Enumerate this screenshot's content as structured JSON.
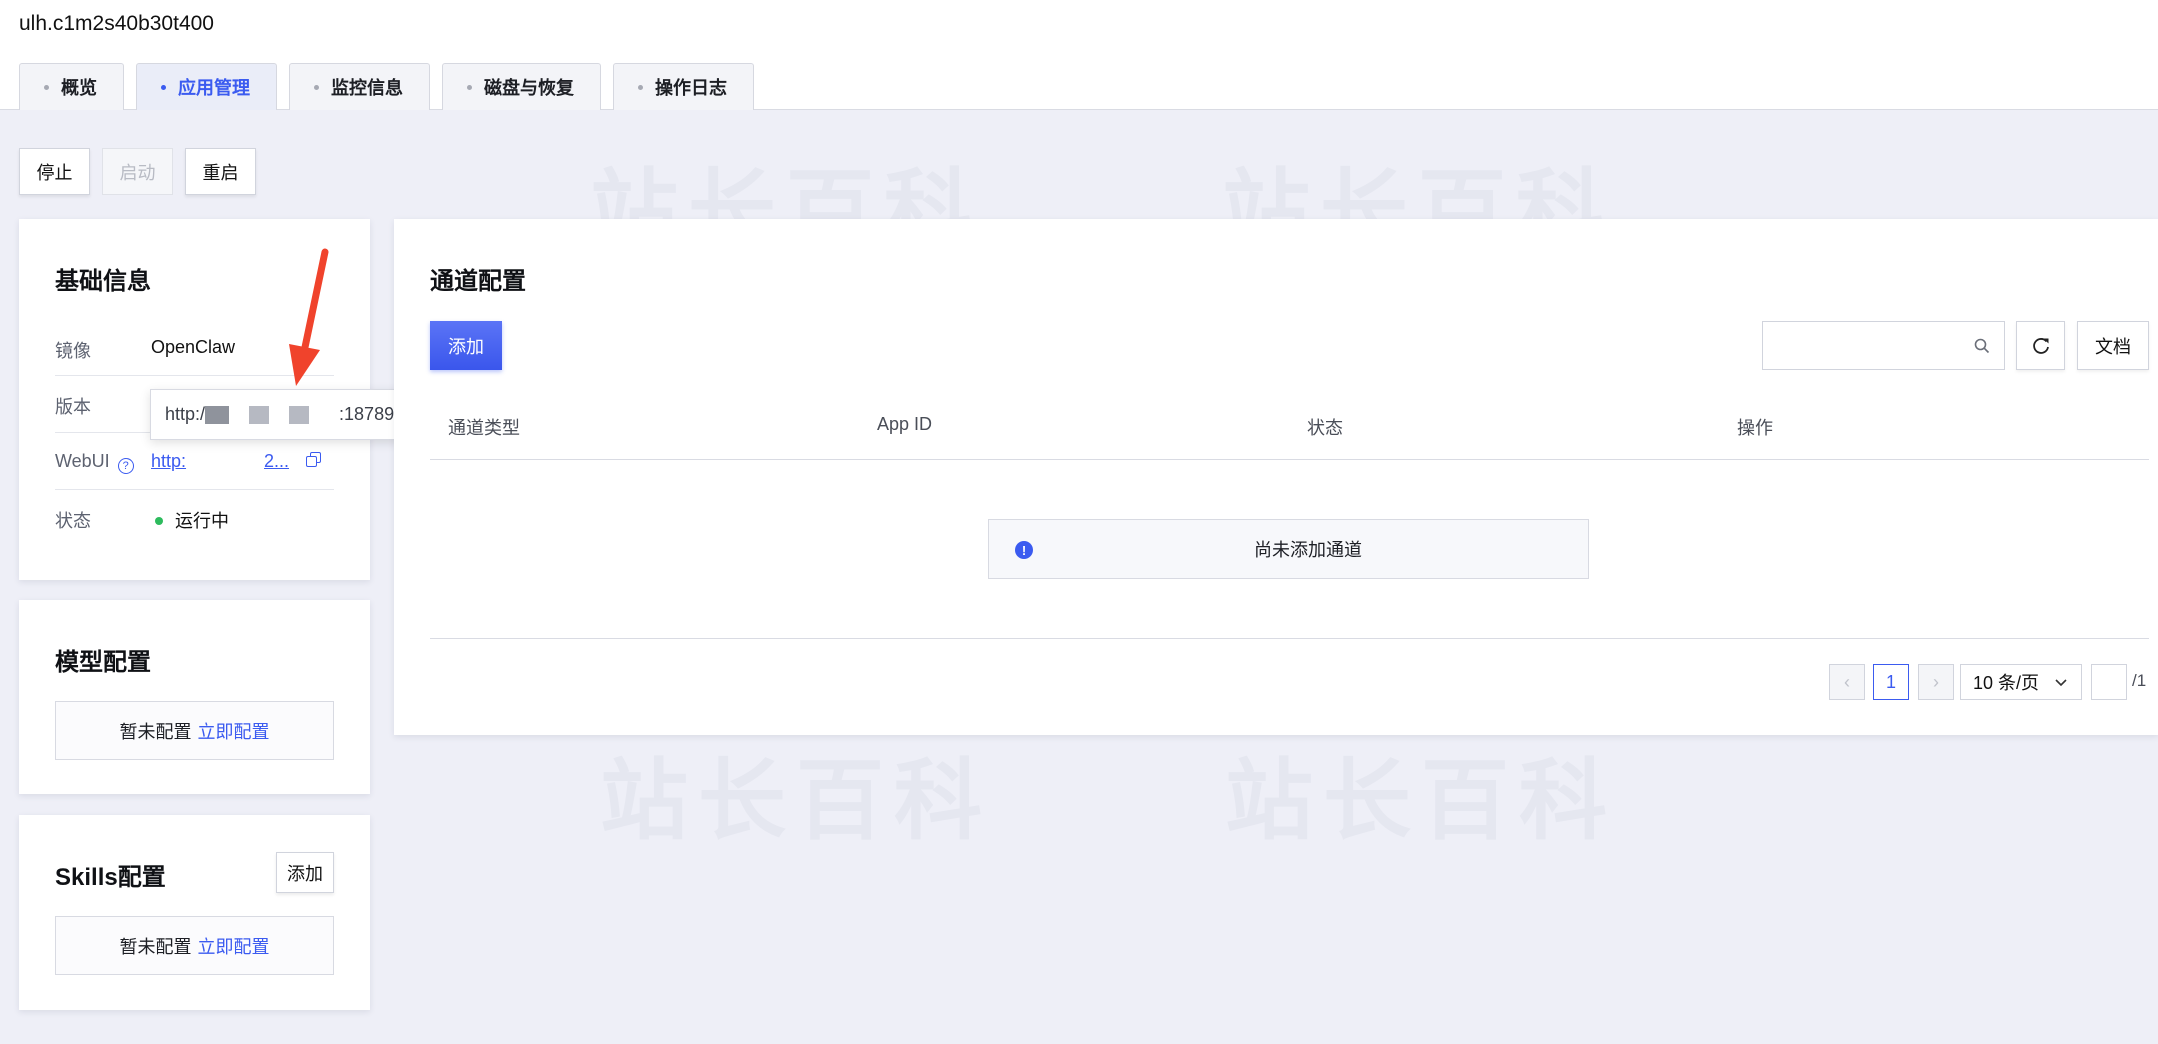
{
  "header": {
    "instance_id": "ulh.c1m2s40b30t400",
    "tabs": [
      {
        "label": "概览",
        "active": false
      },
      {
        "label": "应用管理",
        "active": true
      },
      {
        "label": "监控信息",
        "active": false
      },
      {
        "label": "磁盘与恢复",
        "active": false
      },
      {
        "label": "操作日志",
        "active": false
      }
    ]
  },
  "actions": {
    "stop": "停止",
    "start": "启动",
    "restart": "重启"
  },
  "watermark": "站长百科",
  "basic_info": {
    "title": "基础信息",
    "image_label": "镜像",
    "image_value": "OpenClaw",
    "version_label": "版本",
    "webui_label": "WebUI",
    "webui_link_start": "http:",
    "webui_link_end": "2...",
    "status_label": "状态",
    "status_value": "运行中",
    "tooltip_prefix": "http:/",
    "tooltip_suffix": ":18789"
  },
  "model_config": {
    "title": "模型配置",
    "empty_text": "暂未配置",
    "configure_link": "立即配置"
  },
  "skills_config": {
    "title": "Skills配置",
    "add_label": "添加",
    "empty_text": "暂未配置",
    "configure_link": "立即配置"
  },
  "channel_config": {
    "title": "通道配置",
    "add_label": "添加",
    "search_placeholder": "",
    "docs_label": "文档",
    "columns": [
      "通道类型",
      "App ID",
      "状态",
      "操作"
    ],
    "empty_notice": "尚未添加通道",
    "pagination": {
      "current_page": "1",
      "page_size": "10 条/页",
      "total_pages": "/1"
    }
  },
  "colors": {
    "accent": "#3b5bf0",
    "status_running": "#2dbb5d",
    "annotation_arrow": "#f0432c"
  },
  "icons": [
    "help-circle-icon",
    "copy-icon",
    "search-icon",
    "refresh-icon",
    "info-icon",
    "chevron-left-icon",
    "chevron-right-icon",
    "chevron-down-icon"
  ]
}
